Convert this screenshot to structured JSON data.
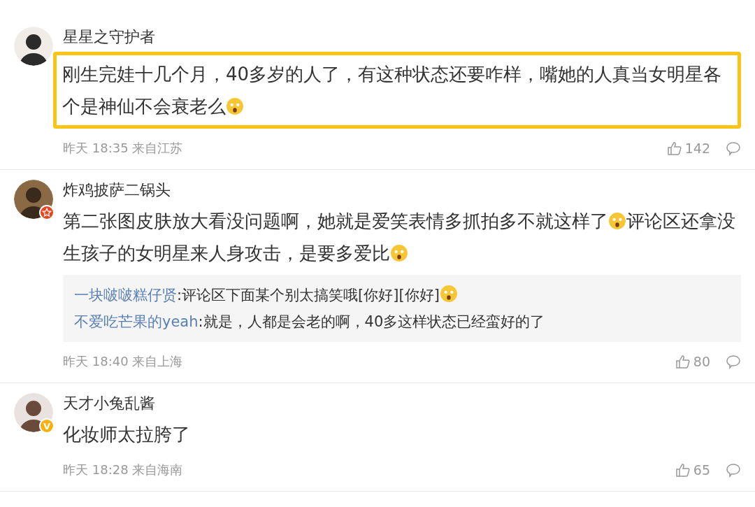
{
  "comments": [
    {
      "author": "星星之守护者",
      "highlighted": true,
      "content": [
        {
          "kind": "text",
          "text": "刚生完娃十几个月，40多岁的人了，有这种状态还要咋样，嘴她的人真当女明星各个是神仙不会衰老么"
        },
        {
          "kind": "emoji"
        }
      ],
      "time": "昨天 18:35 来自江苏",
      "likes": "142"
    },
    {
      "author": "炸鸡披萨二锅头",
      "badge": {
        "kind": "star"
      },
      "highlighted": false,
      "content": [
        {
          "kind": "text",
          "text": "第二张图皮肤放大看没问题啊，她就是爱笑表情多抓拍多不就这样了"
        },
        {
          "kind": "emoji"
        },
        {
          "kind": "text",
          "text": "评论区还拿没生孩子的女明星来人身攻击，是要多爱比"
        },
        {
          "kind": "emoji"
        }
      ],
      "replies": [
        {
          "author": "一块啵啵糕仔贤",
          "content": [
            {
              "kind": "text",
              "text": ":评论区下面某个别太搞笑哦[你好][你好]"
            },
            {
              "kind": "emoji"
            }
          ]
        },
        {
          "author": "不爱吃芒果的yeah",
          "content": [
            {
              "kind": "text",
              "text": ":就是，人都是会老的啊，40多这样状态已经蛮好的了"
            }
          ]
        }
      ],
      "time": "昨天 18:40 来自上海",
      "likes": "80"
    },
    {
      "author": "天才小兔乱酱",
      "badge": {
        "kind": "verified",
        "text": "V"
      },
      "highlighted": false,
      "content": [
        {
          "kind": "text",
          "text": "化妆师太拉胯了"
        }
      ],
      "time": "昨天 18:28 来自海南",
      "likes": "65"
    }
  ]
}
